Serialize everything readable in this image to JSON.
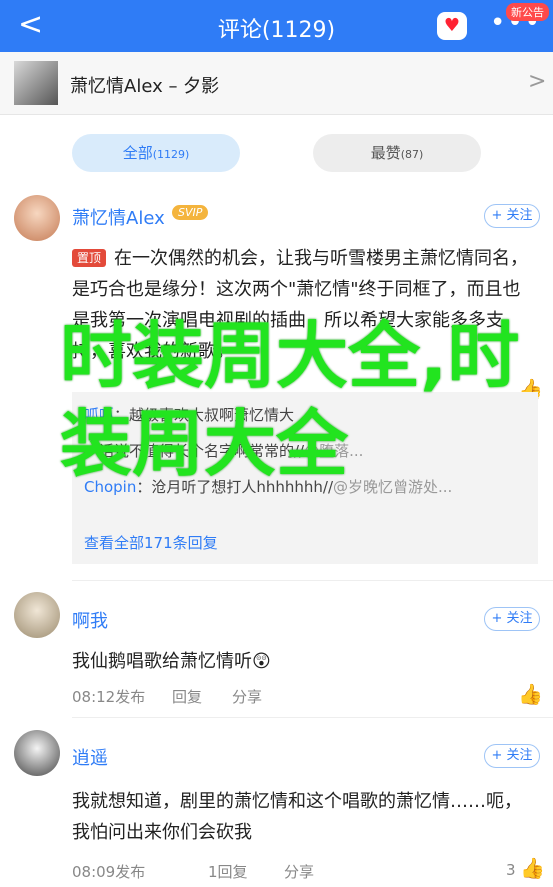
{
  "nav": {
    "back": "<",
    "title": "评论(1129)",
    "heart": "♥",
    "more": "•••",
    "notice": "新公告"
  },
  "song": {
    "title": "萧忆情Alex – 夕影",
    "chev": ">"
  },
  "tabs": {
    "all_label": "全部",
    "all_count": "(1129)",
    "hot_label": "最赞",
    "hot_count": "(87)"
  },
  "comments": [
    {
      "name": "萧忆情Alex",
      "badge": "SVIP",
      "follow": "+ 关注",
      "top": "置顶",
      "text": "在一次偶然的机会，让我与听雪楼男主萧忆情同名，是巧合也是缘分！这次两个\"萧忆情\"终于同框了，而且也是我第一次演唱电视剧的插曲，所以希望大家能多多支持，喜欢我的新歌。",
      "like_count": "1",
      "replies": [
        {
          "who": "呱呱",
          "text": "：越级喜欢大叔啊萧忆情大",
          "at": ""
        },
        {
          "who": "",
          "text": "：话说不值得长个名字啊常常的//",
          "at": "@堕落..."
        },
        {
          "who": "Chopin",
          "text": "：沧月听了想打人hhhhhhh//",
          "at": "@岁晚忆曾游处..."
        }
      ],
      "view_all": "查看全部171条回复"
    },
    {
      "name": "啊我",
      "follow": "+ 关注",
      "text": "我仙鹅唱歌给萧忆情听😲",
      "time": "08:12发布",
      "reply": "回复",
      "share": "分享"
    },
    {
      "name": "逍遥",
      "follow": "+ 关注",
      "text": "我就想知道，剧里的萧忆情和这个唱歌的萧忆情……呃，我怕问出来你们会砍我",
      "time": "08:09发布",
      "reply": "1回复",
      "share": "分享",
      "like_count": "3"
    }
  ],
  "overlay": "时装周大全,时装周大全",
  "colors": {
    "nav": "#2f7cf6",
    "overlay": "#22e41f",
    "link": "#2f7cf6"
  }
}
